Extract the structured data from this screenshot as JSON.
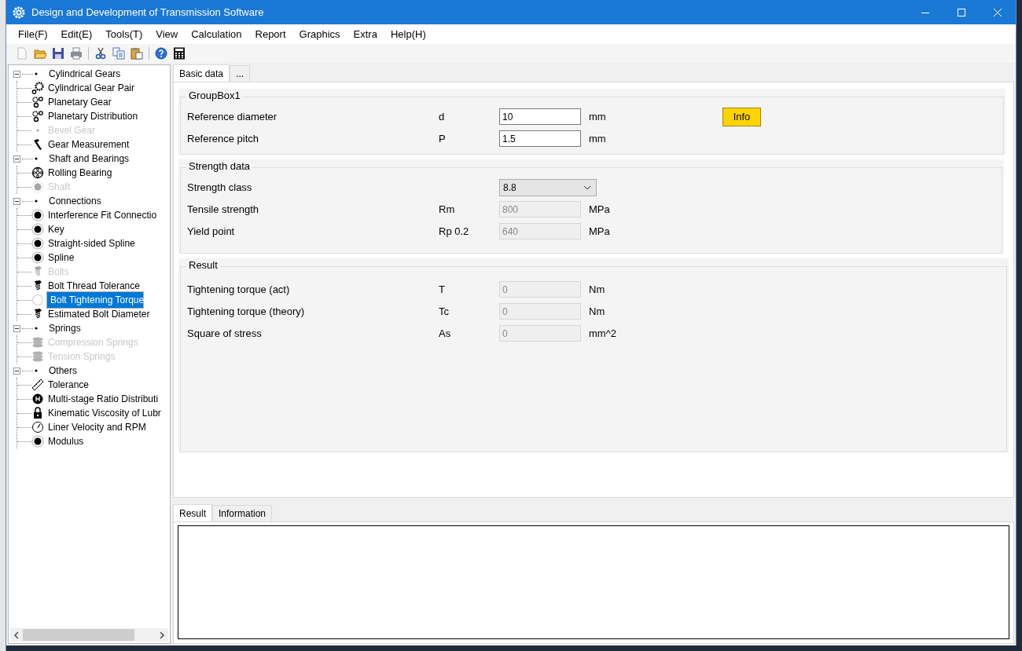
{
  "window": {
    "title": "Design and Development of Transmission Software"
  },
  "menu": [
    "File(F)",
    "Edit(E)",
    "Tools(T)",
    "View",
    "Calculation",
    "Report",
    "Graphics",
    "Extra",
    "Help(H)"
  ],
  "tree": [
    {
      "label": "Cylindrical Gears",
      "expanded": true,
      "children": [
        {
          "label": "Cylindrical Gear Pair",
          "disabled": false,
          "selected": false
        },
        {
          "label": "Planetary Gear",
          "disabled": false,
          "selected": false
        },
        {
          "label": "Planetary Distribution",
          "disabled": false,
          "selected": false
        },
        {
          "label": "Bevel Gear",
          "disabled": true,
          "selected": false
        },
        {
          "label": "Gear Measurement",
          "disabled": false,
          "selected": false
        }
      ]
    },
    {
      "label": "Shaft and Bearings",
      "expanded": true,
      "children": [
        {
          "label": "Rolling Bearing",
          "disabled": false,
          "selected": false
        },
        {
          "label": "Shaft",
          "disabled": true,
          "selected": false
        }
      ]
    },
    {
      "label": "Connections",
      "expanded": true,
      "children": [
        {
          "label": "Interference Fit Connectio",
          "disabled": false,
          "selected": false
        },
        {
          "label": "Key",
          "disabled": false,
          "selected": false
        },
        {
          "label": "Straight-sided Spline",
          "disabled": false,
          "selected": false
        },
        {
          "label": "Spline",
          "disabled": false,
          "selected": false
        },
        {
          "label": "Bolts",
          "disabled": true,
          "selected": false
        },
        {
          "label": "Bolt Thread Tolerance",
          "disabled": false,
          "selected": false
        },
        {
          "label": "Bolt Tightening Torque",
          "disabled": false,
          "selected": true
        },
        {
          "label": "Estimated Bolt Diameter",
          "disabled": false,
          "selected": false
        }
      ]
    },
    {
      "label": "Springs",
      "expanded": true,
      "children": [
        {
          "label": "Compression Springs",
          "disabled": true,
          "selected": false
        },
        {
          "label": "Tension Springs",
          "disabled": true,
          "selected": false
        }
      ]
    },
    {
      "label": "Others",
      "expanded": true,
      "children": [
        {
          "label": "Tolerance",
          "disabled": false,
          "selected": false
        },
        {
          "label": "Multi-stage Ratio Distributi",
          "disabled": false,
          "selected": false
        },
        {
          "label": "Kinematic Viscosity of Lubr",
          "disabled": false,
          "selected": false
        },
        {
          "label": "Liner Velocity and RPM",
          "disabled": false,
          "selected": false
        },
        {
          "label": "Modulus",
          "disabled": false,
          "selected": false
        }
      ]
    }
  ],
  "tabs": [
    {
      "label": "Basic data",
      "selected": true
    },
    {
      "label": "...",
      "selected": false
    }
  ],
  "groups": [
    {
      "title": "GroupBox1",
      "button": "Info",
      "rows": [
        {
          "kind": "input",
          "label": "Reference diameter",
          "symbol": "d",
          "value": "10",
          "unit": "mm"
        },
        {
          "kind": "input",
          "label": "Reference pitch",
          "symbol": "P",
          "value": "1.5",
          "unit": "mm"
        }
      ]
    },
    {
      "title": "Strength data",
      "rows": [
        {
          "kind": "select",
          "label": "Strength class",
          "value": "8.8"
        },
        {
          "kind": "readonly",
          "label": "Tensile strength",
          "symbol": "Rm",
          "value": "800",
          "unit": "MPa"
        },
        {
          "kind": "readonly",
          "label": "Yield point",
          "symbol": "Rp 0.2",
          "value": "640",
          "unit": "MPa"
        }
      ]
    },
    {
      "title": "Result",
      "rows": [
        {
          "kind": "readonly",
          "label": "Tightening torque (act)",
          "symbol": "T",
          "value": "0",
          "unit": "Nm"
        },
        {
          "kind": "readonly",
          "label": "Tightening torque (theory)",
          "symbol": "Tc",
          "value": "0",
          "unit": "Nm"
        },
        {
          "kind": "readonly",
          "label": "Square of stress",
          "symbol": "As",
          "value": "0",
          "unit": "mm^2"
        }
      ]
    }
  ],
  "output_tabs": [
    {
      "label": "Result",
      "selected": true
    },
    {
      "label": "Information",
      "selected": false
    }
  ]
}
